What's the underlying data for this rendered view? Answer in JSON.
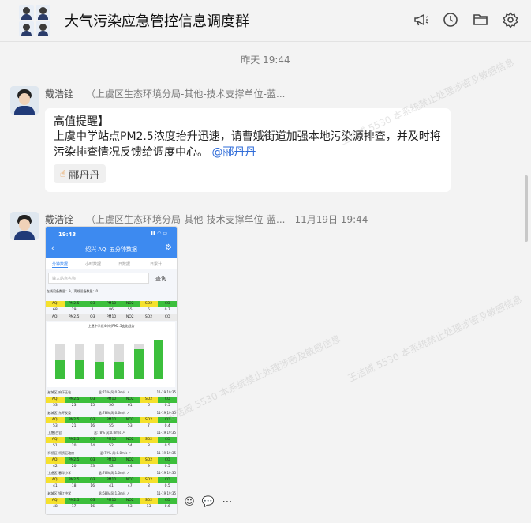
{
  "header": {
    "title": "大气污染应急管控信息调度群"
  },
  "timeline": {
    "timestamp": "昨天 19:44"
  },
  "messages": [
    {
      "sender_name": "戴浩铨",
      "sender_org": "（上虞区生态环境分局-其他-技术支撑单位-蓝...",
      "time": "",
      "text_lines": [
        "高值提醒】",
        "上虞中学站点PM2.5浓度抬升迅速，请曹娥街道加强本地污染源排查，并及时将",
        "污染排查情况反馈给调度中心。"
      ],
      "mention": "@郦丹丹",
      "reaction_user": "郦丹丹"
    },
    {
      "sender_name": "戴浩铨",
      "sender_org": "（上虞区生态环境分局-其他-技术支撑单位-蓝...",
      "time": "11月19日 19:44"
    }
  ],
  "screenshot": {
    "time": "19:43",
    "title": "绍兴 AQI 五分钟数据",
    "tabs": [
      "分钟数据",
      "小时数据",
      "日数据",
      "日累计"
    ],
    "search_placeholder": "输入站点名称",
    "search_button": "查询",
    "online_count": "在线设备数量：9，离线设备数量：0",
    "headers": [
      "AQI",
      "PM2.5",
      "O3",
      "PM10",
      "NO2",
      "SO2",
      "CO"
    ],
    "first_row": [
      "68",
      "29",
      "1",
      "86",
      "55",
      "6",
      "0.7"
    ],
    "chart_title": "上虞中学近4小时PM2.5变化趋势",
    "stations": [
      {
        "name": "[越城区]府下王站",
        "date": "11-19 19:35",
        "values": [
          "53",
          "23",
          "15",
          "56",
          "61",
          "6",
          "0.5"
        ]
      },
      {
        "name": "[越城区]东开发委",
        "date": "11-19 19:35",
        "values": [
          "53",
          "21",
          "16",
          "55",
          "53",
          "7",
          "0.4"
        ]
      },
      {
        "name": "[上虞]百官",
        "date": "11-19 19:35",
        "values": [
          "51",
          "20",
          "14",
          "52",
          "54",
          "8",
          "0.5"
        ]
      },
      {
        "name": "[柯桥区]柯桥区政府",
        "date": "11-19 19:35",
        "values": [
          "42",
          "20",
          "33",
          "42",
          "44",
          "9",
          "0.5"
        ]
      },
      {
        "name": "[上虞区]春华小学",
        "date": "11-19 19:35",
        "values": [
          "41",
          "18",
          "16",
          "41",
          "47",
          "8",
          "0.5"
        ]
      },
      {
        "name": "[越城区]镜江中学",
        "date": "11-19 19:35",
        "values": [
          "48",
          "17",
          "16",
          "45",
          "53",
          "13",
          "0.6"
        ]
      }
    ],
    "station_meta": [
      "温:71%  风:0.3m/s ↗",
      "温:78%  风:0.6m/s ↗",
      "温:78%  风:0.8m/s ↗",
      "温:72%  风:0.8m/s ↗",
      "温:76%  风:1.0m/s ↗",
      "温:68%  风:1.3m/s ↗"
    ]
  },
  "chart_data": {
    "type": "bar",
    "title": "上虞中学近4小时PM2.5变化趋势",
    "categories": [
      "1",
      "2",
      "3",
      "4",
      "5",
      "6"
    ],
    "series": [
      {
        "name": "",
        "values": [
          30,
          30,
          28,
          27,
          47,
          62
        ]
      }
    ]
  },
  "watermark": "王洁威 5530 本系统禁止处理涉密及敏感信息",
  "colors": {
    "accent": "#3d8af0",
    "bar_green": "#3cbf3c",
    "header_yellow": "#f5e12d",
    "mention": "#2e6bd8"
  }
}
